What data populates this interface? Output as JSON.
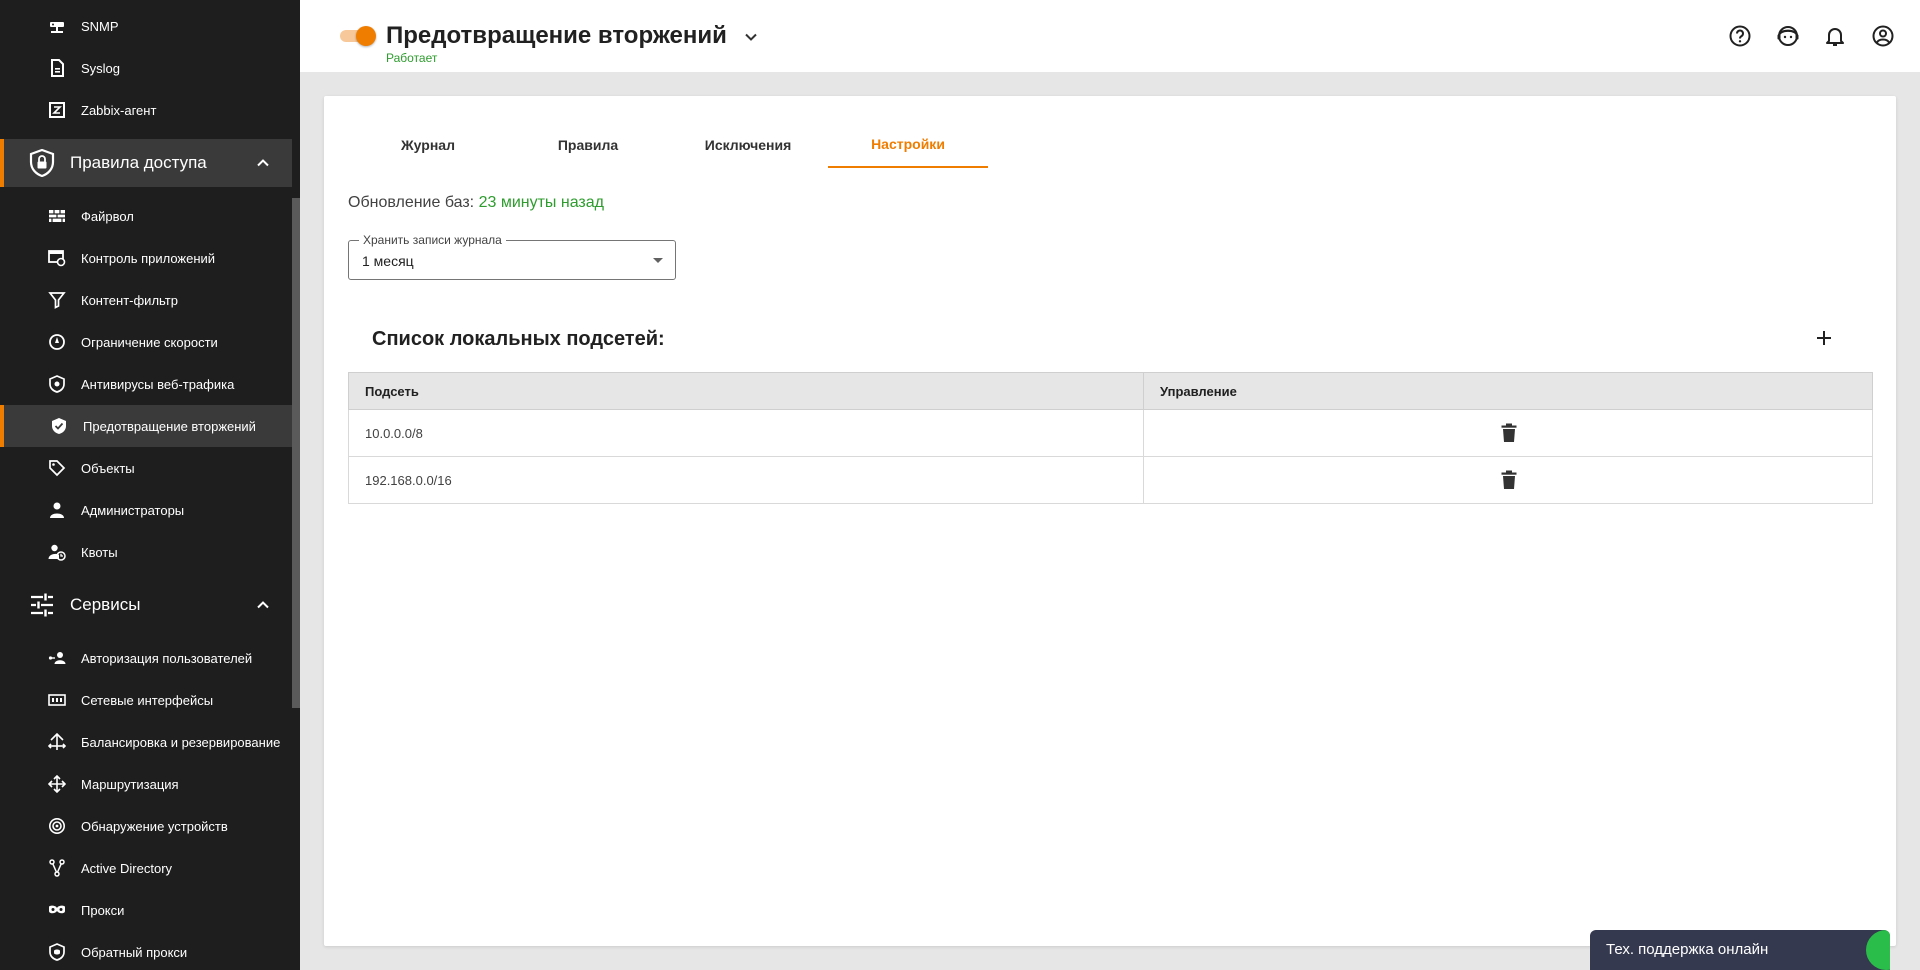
{
  "sidebar": {
    "items_top": [
      {
        "label": "SNMP",
        "icon": "snmp-icon"
      },
      {
        "label": "Syslog",
        "icon": "syslog-icon"
      },
      {
        "label": "Zabbix-агент",
        "icon": "zabbix-icon"
      }
    ],
    "section_access": {
      "label": "Правила доступа",
      "icon": "shield-lock-icon"
    },
    "items_access": [
      {
        "label": "Файрвол",
        "icon": "firewall-icon"
      },
      {
        "label": "Контроль приложений",
        "icon": "app-control-icon"
      },
      {
        "label": "Контент-фильтр",
        "icon": "filter-icon"
      },
      {
        "label": "Ограничение скорости",
        "icon": "speed-limit-icon"
      },
      {
        "label": "Антивирусы веб-трафика",
        "icon": "antivirus-icon"
      },
      {
        "label": "Предотвращение вторжений",
        "icon": "shield-check-icon",
        "active": true
      },
      {
        "label": "Объекты",
        "icon": "tag-icon"
      },
      {
        "label": "Администраторы",
        "icon": "admin-icon"
      },
      {
        "label": "Квоты",
        "icon": "quota-icon"
      }
    ],
    "section_services": {
      "label": "Сервисы",
      "icon": "sliders-icon"
    },
    "items_services": [
      {
        "label": "Авторизация пользователей",
        "icon": "user-auth-icon"
      },
      {
        "label": "Сетевые интерфейсы",
        "icon": "network-interface-icon"
      },
      {
        "label": "Балансировка и резервирование",
        "icon": "balancing-icon"
      },
      {
        "label": "Маршрутизация",
        "icon": "routing-icon"
      },
      {
        "label": "Обнаружение устройств",
        "icon": "discovery-icon"
      },
      {
        "label": "Active Directory",
        "icon": "active-directory-icon"
      },
      {
        "label": "Прокси",
        "icon": "proxy-icon"
      },
      {
        "label": "Обратный прокси",
        "icon": "reverse-proxy-icon"
      }
    ]
  },
  "header": {
    "title": "Предотвращение вторжений",
    "status": "Работает",
    "accent": "#ef7d00",
    "status_color": "#2e9c2e"
  },
  "tabs": [
    {
      "label": "Журнал"
    },
    {
      "label": "Правила"
    },
    {
      "label": "Исключения"
    },
    {
      "label": "Настройки",
      "active": true
    }
  ],
  "settings": {
    "db_update_label": "Обновление баз:",
    "db_update_value": "23 минуты назад",
    "log_retention_label": "Хранить записи журнала",
    "log_retention_value": "1 месяц",
    "subnets_title": "Список локальных подсетей:",
    "table": {
      "columns": [
        "Подсеть",
        "Управление"
      ],
      "rows": [
        {
          "subnet": "10.0.0.0/8"
        },
        {
          "subnet": "192.168.0.0/16"
        }
      ]
    }
  },
  "support": {
    "label": "Тех. поддержка онлайн"
  }
}
